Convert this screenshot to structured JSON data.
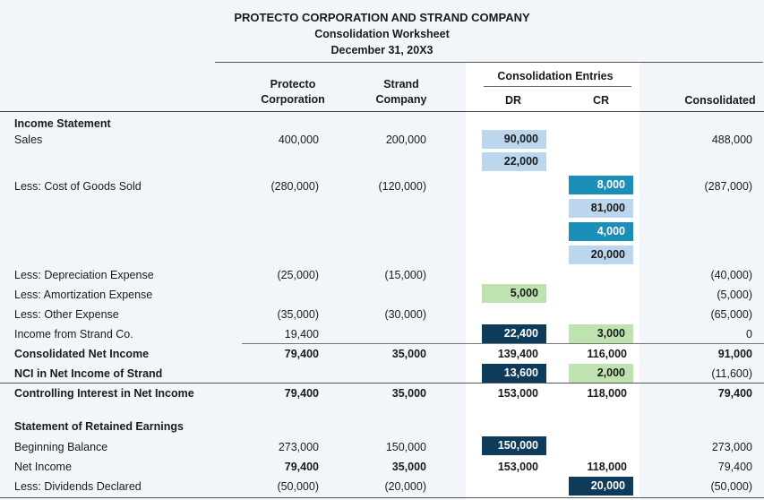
{
  "title": {
    "line1": "PROTECTO CORPORATION AND STRAND COMPANY",
    "line2": "Consolidation Worksheet",
    "line3": "December 31, 20X3"
  },
  "headers": {
    "protecto": [
      "Protecto",
      "Corporation"
    ],
    "strand": [
      "Strand",
      "Company"
    ],
    "entries": "Consolidation Entries",
    "dr": "DR",
    "cr": "CR",
    "consolidated": "Consolidated"
  },
  "sections": {
    "income_statement": "Income Statement",
    "retained_earnings": "Statement of Retained Earnings"
  },
  "rows": {
    "sales": {
      "label": "Sales",
      "protecto": "400,000",
      "strand": "200,000",
      "dr": [
        "90,000",
        "22,000"
      ],
      "consolidated": "488,000"
    },
    "cogs": {
      "label": "Less: Cost of Goods Sold",
      "protecto": "(280,000)",
      "strand": "(120,000)",
      "cr": [
        "8,000",
        "81,000",
        "4,000",
        "20,000"
      ],
      "consolidated": "(287,000)"
    },
    "depreciation": {
      "label": "Less: Depreciation Expense",
      "protecto": "(25,000)",
      "strand": "(15,000)",
      "consolidated": "(40,000)"
    },
    "amortization": {
      "label": "Less: Amortization Expense",
      "dr": "5,000",
      "consolidated": "(5,000)"
    },
    "other": {
      "label": "Less: Other Expense",
      "protecto": "(35,000)",
      "strand": "(30,000)",
      "consolidated": "(65,000)"
    },
    "income_strand": {
      "label": "Income from Strand Co.",
      "protecto": "19,400",
      "dr": "22,400",
      "cr": "3,000",
      "consolidated": "0"
    },
    "cni": {
      "label": "Consolidated Net Income",
      "protecto": "79,400",
      "strand": "35,000",
      "dr": "139,400",
      "cr": "116,000",
      "consolidated": "91,000"
    },
    "nci": {
      "label": "NCI in Net Income of Strand",
      "dr": "13,600",
      "cr": "2,000",
      "consolidated": "(11,600)"
    },
    "controlling": {
      "label": "Controlling Interest in Net Income",
      "protecto": "79,400",
      "strand": "35,000",
      "dr": "153,000",
      "cr": "118,000",
      "consolidated": "79,400"
    },
    "beginning": {
      "label": "Beginning Balance",
      "protecto": "273,000",
      "strand": "150,000",
      "dr": "150,000",
      "consolidated": "273,000"
    },
    "net_income": {
      "label": "Net Income",
      "protecto": "79,400",
      "strand": "35,000",
      "dr": "153,000",
      "cr": "118,000",
      "consolidated": "79,400"
    },
    "dividends": {
      "label": "Less: Dividends Declared",
      "protecto": "(50,000)",
      "strand": "(20,000)",
      "cr": "20,000",
      "consolidated": "(50,000)"
    }
  },
  "colors": {
    "light_blue": "#bcd6ee",
    "mid_blue": "#1b8fb8",
    "dark_navy": "#0f3b5a",
    "light_green": "#bfe3b0",
    "page_bg": "#f2f6fb"
  }
}
